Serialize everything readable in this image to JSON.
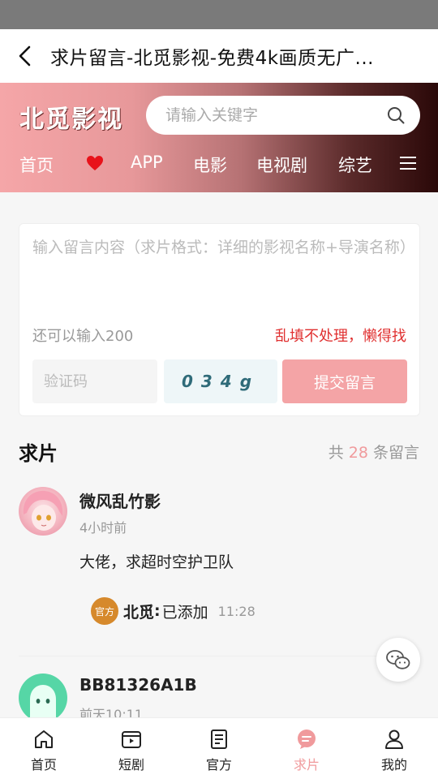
{
  "titlebar": {
    "title": "求片留言-北觅影视-免费4k画质无广..."
  },
  "header": {
    "logo": "北觅影视",
    "search_placeholder": "请输入关键字",
    "nav": [
      "首页",
      "APP",
      "电影",
      "电视剧",
      "综艺"
    ]
  },
  "comment_form": {
    "placeholder": "输入留言内容（求片格式：详细的影视名称+导演名称）",
    "remaining": "还可以输入200",
    "warning": "乱填不处理，懒得找",
    "captcha_placeholder": "验证码",
    "captcha_text": "034g",
    "submit_label": "提交留言"
  },
  "section": {
    "title": "求片",
    "count_prefix": "共",
    "count": "28",
    "count_suffix": "条留言"
  },
  "messages": [
    {
      "username": "微风乱竹影",
      "time": "4小时前",
      "content": "大佬，求超时空护卫队",
      "reply": {
        "badge": "官方",
        "name": "北觅",
        "colon": ":",
        "text": "已添加",
        "time": "11:28"
      }
    },
    {
      "username": "BB81326A1B",
      "time": "前天10:11"
    }
  ],
  "tabbar": [
    {
      "label": "首页",
      "icon": "home-icon"
    },
    {
      "label": "短剧",
      "icon": "video-icon"
    },
    {
      "label": "官方",
      "icon": "document-icon"
    },
    {
      "label": "求片",
      "icon": "chat-bubble-icon",
      "active": true
    },
    {
      "label": "我的",
      "icon": "user-icon"
    }
  ],
  "colors": {
    "accent": "#f09a9c",
    "warning": "#e03030",
    "official_badge": "#d6892c"
  }
}
